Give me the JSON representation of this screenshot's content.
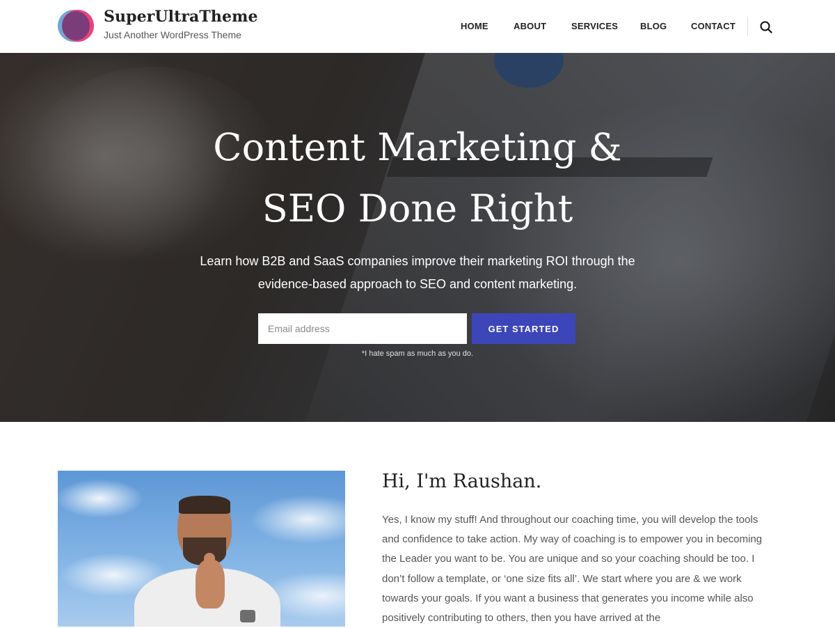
{
  "site": {
    "title": "SuperUltraTheme",
    "tagline": "Just Another WordPress Theme"
  },
  "nav": {
    "items": [
      {
        "label": "HOME"
      },
      {
        "label": "ABOUT"
      },
      {
        "label": "SERVICES"
      },
      {
        "label": "BLOG"
      },
      {
        "label": "CONTACT"
      }
    ],
    "search_icon": "search-icon"
  },
  "hero": {
    "title_line1": "Content Marketing &",
    "title_line2": "SEO Done Right",
    "subtitle_line1": "Learn how B2B and SaaS companies improve their marketing ROI through the",
    "subtitle_line2": "evidence-based approach to SEO and content marketing.",
    "email_placeholder": "Email address",
    "cta_label": "GET STARTED",
    "spam_note": "*I hate spam as much as you do."
  },
  "about": {
    "heading": "Hi, I'm Raushan.",
    "text": "Yes, I know my stuff! And throughout our coaching time, you will develop the tools and confidence to take action. My way of coaching is to empower you in becoming the Leader you want to be. You are unique and so your coaching should be too. I don’t follow a template, or ‘one size fits all’. We start where you are & we work towards your goals. If you want a business that generates you income while also positively contributing to others, then you have arrived at the"
  },
  "colors": {
    "accent": "#3d46b8",
    "logo_pink": "#e9447f",
    "logo_purple": "#7b3d7a",
    "logo_blue": "#6fa6d6"
  }
}
